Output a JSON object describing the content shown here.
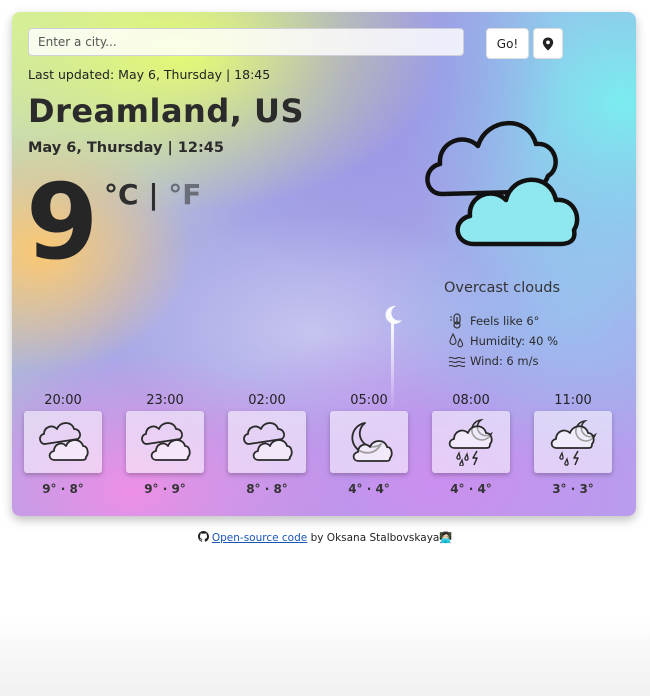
{
  "search": {
    "placeholder": "Enter a city..."
  },
  "buttons": {
    "go_label": "Go!",
    "location_icon": "map-marker-icon"
  },
  "last_updated": "Last updated: May 6, Thursday | 18:45",
  "city": "Dreamland, US",
  "local_datetime": "May 6, Thursday | 12:45",
  "current": {
    "temperature": "9",
    "unit_celsius": "°C",
    "unit_separator": "|",
    "unit_fahrenheit": "°F",
    "active_unit": "celsius",
    "icon": "overcast-clouds-icon",
    "description": "Overcast clouds",
    "feels_like": "Feels like 6°",
    "humidity": "Humidity: 40 %",
    "wind": "Wind: 6 m/s"
  },
  "forecast": [
    {
      "time": "20:00",
      "icon": "clouds-icon",
      "temps": "9° · 8°"
    },
    {
      "time": "23:00",
      "icon": "clouds-icon",
      "temps": "9° · 9°"
    },
    {
      "time": "02:00",
      "icon": "clouds-icon",
      "temps": "8° · 8°"
    },
    {
      "time": "05:00",
      "icon": "moon-cloud-icon",
      "temps": "4° · 4°"
    },
    {
      "time": "08:00",
      "icon": "night-rain-icon",
      "temps": "4° · 4°"
    },
    {
      "time": "11:00",
      "icon": "night-thunderstorm-icon",
      "temps": "3° · 3°"
    }
  ],
  "footer": {
    "link_text": "Open-source code",
    "text": " by Oksana Stalbovskaya",
    "emoji": "👩🏻‍💻",
    "icon": "github-icon"
  },
  "colors": {
    "link": "#1a55b8",
    "fahrenheit_inactive": "#6a6e78",
    "text_dark": "#2b2b2b"
  }
}
